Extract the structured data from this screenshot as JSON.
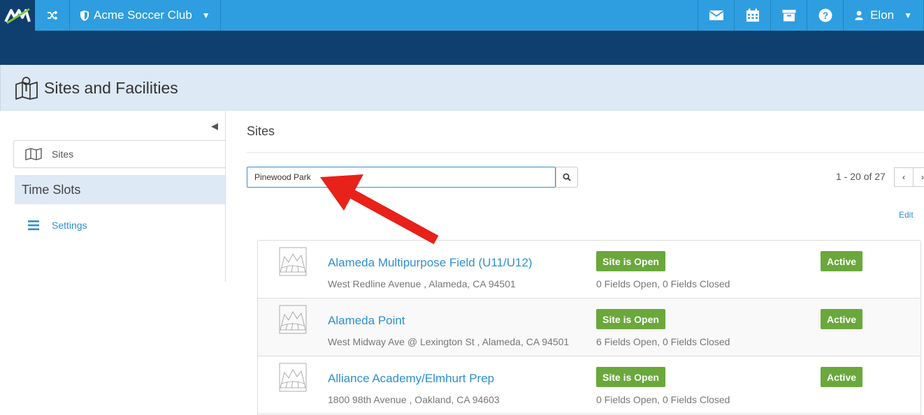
{
  "topbar": {
    "club_name": "Acme Soccer Club",
    "user_name": "Elon",
    "colors": {
      "bar": "#2e9ee0",
      "dark": "#0e3f6e"
    }
  },
  "page": {
    "title": "Sites and Facilities"
  },
  "sidebar": {
    "items": [
      {
        "label": "Sites",
        "icon": "map-icon"
      },
      {
        "label": "Time Slots"
      },
      {
        "label": "Settings",
        "icon": "list-icon"
      }
    ]
  },
  "main": {
    "title": "Sites",
    "search": {
      "value": "Pinewood Park",
      "placeholder": ""
    },
    "pagination": {
      "label": "1 - 20 of 27"
    },
    "edit_label": "Edit",
    "sites": [
      {
        "name": "Alameda Multipurpose Field (U11/U12)",
        "address": "West Redline Avenue , Alameda, CA 94501",
        "status": "Site is Open",
        "fields": "0 Fields Open, 0 Fields Closed",
        "state": "Active"
      },
      {
        "name": "Alameda Point",
        "address": "West Midway Ave @ Lexington St , Alameda, CA 94501",
        "status": "Site is Open",
        "fields": "6 Fields Open, 0 Fields Closed",
        "state": "Active"
      },
      {
        "name": "Alliance Academy/Elmhurt Prep",
        "address": "1800 98th Avenue , Oakland, CA 94603",
        "status": "Site is Open",
        "fields": "0 Fields Open, 0 Fields Closed",
        "state": "Active"
      }
    ]
  },
  "annotation": {
    "color": "#e8211b"
  }
}
